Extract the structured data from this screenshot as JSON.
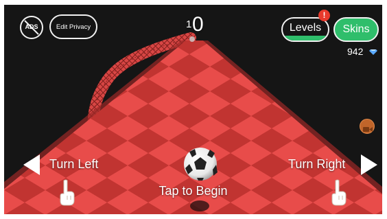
{
  "hud": {
    "ads_label": "ADS",
    "edit_privacy_label": "Edit Privacy",
    "score": "0",
    "score_prefix": "1",
    "levels_label": "Levels",
    "levels_badge": "!",
    "skins_label": "Skins",
    "gems": "942"
  },
  "controls": {
    "turn_left": "Turn Left",
    "turn_right": "Turn Right",
    "tap_to_begin": "Tap to Begin"
  },
  "icons": {
    "ads": "no-ads-icon",
    "gem": "diamond-icon",
    "video": "video-camera-icon",
    "left": "left-triangle-icon",
    "right": "right-triangle-icon",
    "hand": "pointing-hand-icon",
    "ball": "soccer-ball-icon"
  },
  "colors": {
    "background": "#151515",
    "track": "#e84c4a",
    "track_pattern": "#b9302d",
    "skins_button": "#2fbe6b",
    "levels_bar": "#2fbe6b",
    "badge": "#e83a2c",
    "gem": "#5aa9ff",
    "video_button": "#c0652a"
  }
}
